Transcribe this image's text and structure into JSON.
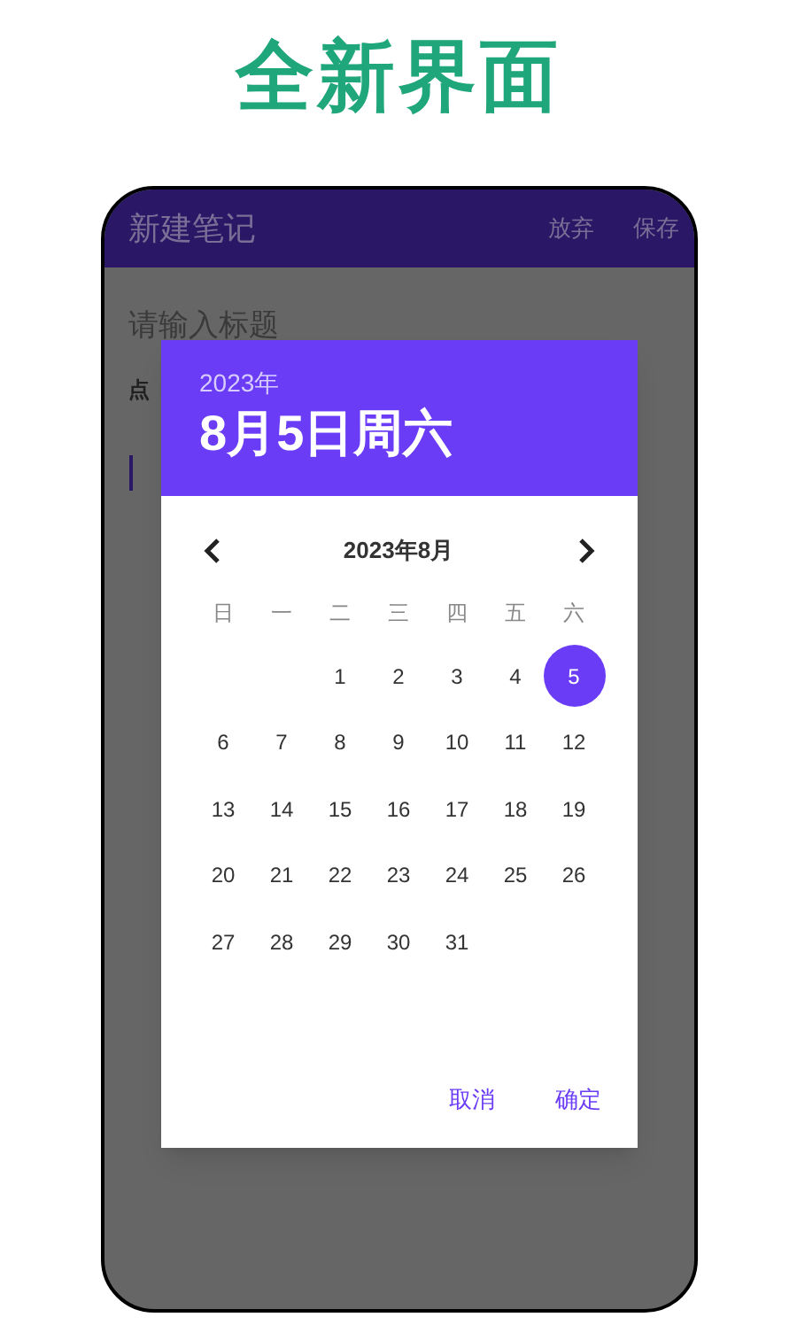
{
  "banner": {
    "title": "全新界面"
  },
  "app_bar": {
    "title": "新建笔记",
    "actions": [
      "放弃",
      "保存"
    ]
  },
  "note": {
    "title_placeholder": "请输入标题",
    "hint": "点"
  },
  "date_picker": {
    "year": "2023年",
    "date": "8月5日周六",
    "month": "2023年8月",
    "weekdays": [
      "日",
      "一",
      "二",
      "三",
      "四",
      "五",
      "六"
    ],
    "weeks": [
      {
        "days": [
          {
            "label": "1",
            "selected": false
          },
          {
            "label": "2",
            "selected": false
          },
          {
            "label": "3",
            "selected": false
          },
          {
            "label": "4",
            "selected": false
          },
          {
            "label": "5",
            "selected": true
          }
        ]
      },
      {
        "days": [
          {
            "label": "6",
            "selected": false
          },
          {
            "label": "7",
            "selected": false
          },
          {
            "label": "8",
            "selected": false
          },
          {
            "label": "9",
            "selected": false
          },
          {
            "label": "10",
            "selected": false
          },
          {
            "label": "11",
            "selected": false
          },
          {
            "label": "12",
            "selected": false
          }
        ]
      },
      {
        "days": [
          {
            "label": "13",
            "selected": false
          },
          {
            "label": "14",
            "selected": false
          },
          {
            "label": "15",
            "selected": false
          },
          {
            "label": "16",
            "selected": false
          },
          {
            "label": "17",
            "selected": false
          },
          {
            "label": "18",
            "selected": false
          },
          {
            "label": "19",
            "selected": false
          }
        ]
      },
      {
        "days": [
          {
            "label": "20",
            "selected": false
          },
          {
            "label": "21",
            "selected": false
          },
          {
            "label": "22",
            "selected": false
          },
          {
            "label": "23",
            "selected": false
          },
          {
            "label": "24",
            "selected": false
          },
          {
            "label": "25",
            "selected": false
          },
          {
            "label": "26",
            "selected": false
          }
        ]
      },
      {
        "days": [
          {
            "label": "27",
            "selected": false
          },
          {
            "label": "28",
            "selected": false
          },
          {
            "label": "29",
            "selected": false
          },
          {
            "label": "30",
            "selected": false
          },
          {
            "label": "31",
            "selected": false
          }
        ]
      }
    ],
    "buttons": [
      "取消",
      "确定"
    ]
  }
}
